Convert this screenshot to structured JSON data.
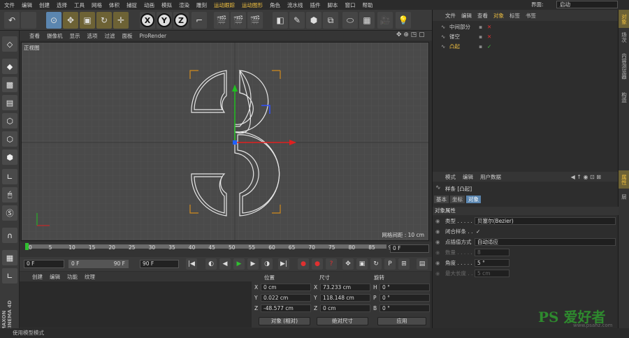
{
  "menu": [
    "文件",
    "编辑",
    "创建",
    "选择",
    "工具",
    "网格",
    "体积",
    "捕捉",
    "动画",
    "模拟",
    "渲染",
    "雕刻",
    "运动跟踪",
    "运动图形",
    "角色",
    "流水线",
    "插件",
    "脚本",
    "窗口",
    "帮助"
  ],
  "layout": {
    "label": "界面:",
    "value": "启动"
  },
  "viewport_menu": [
    "查看",
    "摄像机",
    "显示",
    "选项",
    "过滤",
    "面板",
    "ProRender"
  ],
  "viewport": {
    "label": "正视图",
    "grid_info": "网格间距 : 10 cm"
  },
  "timeline": {
    "ticks": [
      "0",
      "5",
      "10",
      "15",
      "20",
      "25",
      "30",
      "35",
      "40",
      "45",
      "50",
      "55",
      "60",
      "65",
      "70",
      "75",
      "80",
      "85",
      "90"
    ],
    "current": "0 F",
    "start": "0 F",
    "min": "0 F",
    "max": "90 F",
    "end": "90 F"
  },
  "bottom_tabs": [
    "创建",
    "编辑",
    "功能",
    "纹理"
  ],
  "coords": {
    "headers": [
      "位置",
      "尺寸",
      "旋转"
    ],
    "position": [
      {
        "axis": "X",
        "value": "0 cm"
      },
      {
        "axis": "Y",
        "value": "0.022 cm"
      },
      {
        "axis": "Z",
        "value": "-48.577 cm"
      }
    ],
    "size": [
      {
        "axis": "X",
        "value": "73.233 cm"
      },
      {
        "axis": "Y",
        "value": "118.148 cm"
      },
      {
        "axis": "Z",
        "value": "0 cm"
      }
    ],
    "rotation": [
      {
        "axis": "H",
        "value": "0 °"
      },
      {
        "axis": "P",
        "value": "0 °"
      },
      {
        "axis": "B",
        "value": "0 °"
      }
    ],
    "mode1": "对象 (相对)",
    "mode2": "绝对尺寸",
    "apply": "应用"
  },
  "status": "使用模型模式",
  "object_manager": {
    "tabs": [
      "文件",
      "编辑",
      "查看",
      "对象",
      "标签",
      "书签"
    ],
    "objects": [
      {
        "name": "中间部分"
      },
      {
        "name": "镂空"
      },
      {
        "name": "凸起",
        "selected": true
      }
    ]
  },
  "right_tabs": [
    "对象",
    "场次",
    "内容浏览器",
    "构造",
    "属性",
    "层"
  ],
  "attributes": {
    "menu": [
      "模式",
      "编辑",
      "用户数据"
    ],
    "title": "样条 [凸起]",
    "tabs": [
      "基本",
      "坐标",
      "对象"
    ],
    "section": "对象属性",
    "rows": [
      {
        "label": "类型 . . . . . . .",
        "value": "贝塞尔(Bezier)",
        "kind": "select"
      },
      {
        "label": "闭合样条 . .",
        "value": "✓",
        "kind": "check"
      },
      {
        "label": "点插值方式",
        "value": "自动适应",
        "kind": "select"
      },
      {
        "label": "数量 . . . . . . .",
        "value": "8",
        "kind": "num",
        "dim": true
      },
      {
        "label": "角度 . . . . . . .",
        "value": "5 °",
        "kind": "num"
      },
      {
        "label": "最大长度 . . .",
        "value": "5 cm",
        "kind": "num",
        "dim": true
      }
    ]
  },
  "watermark": {
    "text": "PS 爱好者",
    "url": "www.psahz.com"
  }
}
